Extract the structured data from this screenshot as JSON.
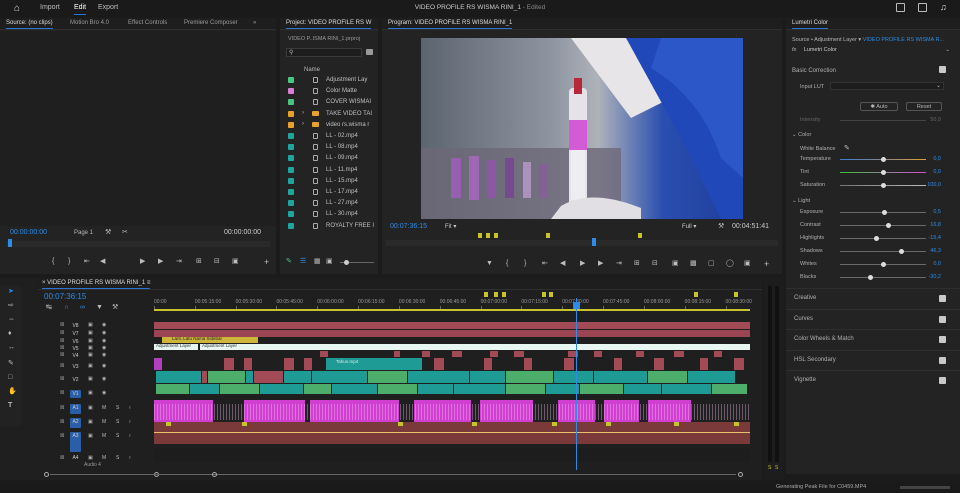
{
  "app": {
    "title": "VIDEO PROFILE RS WISMA RINI_1",
    "edited": "- Edited",
    "nav": {
      "import": "Import",
      "edit": "Edit",
      "export": "Export"
    }
  },
  "source_panel": {
    "tabs": [
      "Source: (no clips)",
      "Motion Bro 4.0",
      "Effect Controls",
      "Premiere Composer"
    ],
    "more": "»",
    "timecode_left": "00:00:00:00",
    "page": "Page 1",
    "timecode_right": "00:00:00:00"
  },
  "project_panel": {
    "tab": "Project: VIDEO PROFILE RS W",
    "path": "VIDEO P..ISMA RINI_1.prproj",
    "column": "Name",
    "items": [
      {
        "name": "Adjustment Lay",
        "color": "#4ac486",
        "kind": "file"
      },
      {
        "name": "Color Matte",
        "color": "#d77ed6",
        "kind": "file"
      },
      {
        "name": "COVER WISMAI",
        "color": "#4ac486",
        "kind": "file"
      },
      {
        "name": "TAKE VIDEO TAI",
        "color": "#e8a12b",
        "kind": "folder"
      },
      {
        "name": "video rs.wisma r",
        "color": "#e8a12b",
        "kind": "folder"
      },
      {
        "name": "LL - 02.mp4",
        "color": "#1fa5a0",
        "kind": "file"
      },
      {
        "name": "LL - 08.mp4",
        "color": "#1fa5a0",
        "kind": "file"
      },
      {
        "name": "LL - 09.mp4",
        "color": "#1fa5a0",
        "kind": "file"
      },
      {
        "name": "LL - 11.mp4",
        "color": "#1fa5a0",
        "kind": "file"
      },
      {
        "name": "LL - 15.mp4",
        "color": "#1fa5a0",
        "kind": "file"
      },
      {
        "name": "LL - 17.mp4",
        "color": "#1fa5a0",
        "kind": "file"
      },
      {
        "name": "LL - 27.mp4",
        "color": "#1fa5a0",
        "kind": "file"
      },
      {
        "name": "LL - 30.mp4",
        "color": "#1fa5a0",
        "kind": "file"
      },
      {
        "name": "ROYALTY FREE I",
        "color": "#1fa5a0",
        "kind": "file"
      }
    ]
  },
  "program_panel": {
    "tab": "Program: VIDEO PROFILE RS WISMA RINI_1",
    "timecode": "00:07:36:15",
    "fit": "Fit",
    "quality": "Full",
    "duration": "00:04:51:41"
  },
  "lumetri": {
    "title": "Lumetri Color",
    "source": "Source • Adjustment Layer",
    "target": "VIDEO PROFILE RS WISMA R...",
    "effect": "Lumetri Color",
    "fx": "fx",
    "basic": "Basic Correction",
    "input_lut": "Input LUT",
    "auto": "Auto",
    "reset": "Reset",
    "intensity_label": "Intensity",
    "intensity_value": "50,0",
    "color_section": "Color",
    "white_balance": "White Balance",
    "color_sliders": [
      {
        "label": "Temperature",
        "value": "0,0",
        "pos": 0.5
      },
      {
        "label": "Tint",
        "value": "0,0",
        "pos": 0.5
      },
      {
        "label": "Saturation",
        "value": "100,0",
        "pos": 0.5
      }
    ],
    "light_section": "Light",
    "light_sliders": [
      {
        "label": "Exposure",
        "value": "0,5",
        "pos": 0.52
      },
      {
        "label": "Contrast",
        "value": "16,8",
        "pos": 0.56
      },
      {
        "label": "Highlights",
        "value": "-15,4",
        "pos": 0.42
      },
      {
        "label": "Shadows",
        "value": "46,3",
        "pos": 0.72
      },
      {
        "label": "Whites",
        "value": "0,0",
        "pos": 0.5
      },
      {
        "label": "Blacks",
        "value": "-30,2",
        "pos": 0.35
      }
    ],
    "sections": [
      "Creative",
      "Curves",
      "Color Wheels & Match",
      "HSL Secondary",
      "Vignette"
    ]
  },
  "timeline": {
    "tab": "VIDEO PROFILE RS WISMA RINI_1",
    "timecode": "00:07:36:15",
    "ruler": [
      "00:00",
      "00:05:15:00",
      "00:05:30:00",
      "00:05:45:00",
      "00:06:00:00",
      "00:06:15:00",
      "00:06:30:00",
      "00:06:45:00",
      "00:07:00:00",
      "00:07:15:00",
      "00:07:30:00",
      "00:07:45:00",
      "00:08:00:00",
      "00:08:15:00",
      "00:08:30:00"
    ],
    "video_tracks": [
      "V8",
      "V7",
      "V6",
      "V5",
      "V4",
      "V3",
      "V2",
      "V1"
    ],
    "audio_tracks": [
      "A1",
      "A2",
      "A3",
      "A4"
    ],
    "audio4_name": "Audio 4",
    "clip_labels": {
      "v6": "Lant..Latu Nama Sidebar",
      "v5a": "Adjustment Layer",
      "v5b": "Adjustment Layer",
      "v3": "Tahun.mp4"
    },
    "mute": "M",
    "solo": "S",
    "meter_labels": [
      "S",
      "S"
    ]
  },
  "status": "Generating Peak File for C0459.MP4"
}
